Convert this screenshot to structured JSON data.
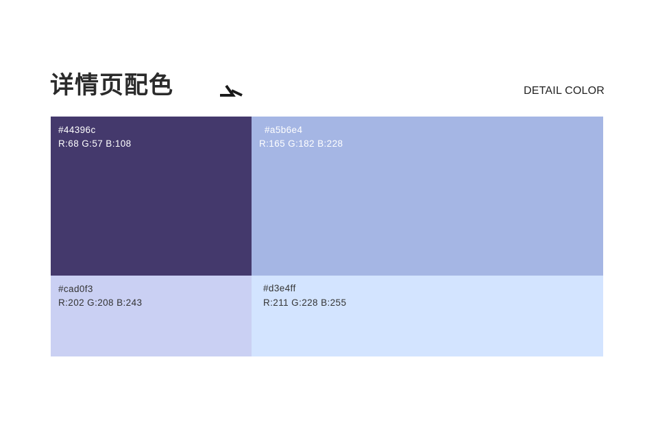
{
  "header": {
    "title": "详情页配色",
    "subtitle": "DETAIL COLOR",
    "decoration_icon": "corner-arrow-icon"
  },
  "swatches": [
    {
      "hex": "#44396c",
      "rgb": "R:68 G:57 B:108",
      "color": "#44396c",
      "text_color": "#ffffff"
    },
    {
      "hex": "#a5b6e4",
      "rgb": "R:165 G:182 B:228",
      "color": "#a5b6e4",
      "text_color": "#ffffff"
    },
    {
      "hex": "#cad0f3",
      "rgb": "R:202 G:208 B:243",
      "color": "#cad0f3",
      "text_color": "#333333"
    },
    {
      "hex": "#d3e4ff",
      "rgb": "R:211 G:228 B:255",
      "color": "#d3e4ff",
      "text_color": "#333333"
    }
  ]
}
